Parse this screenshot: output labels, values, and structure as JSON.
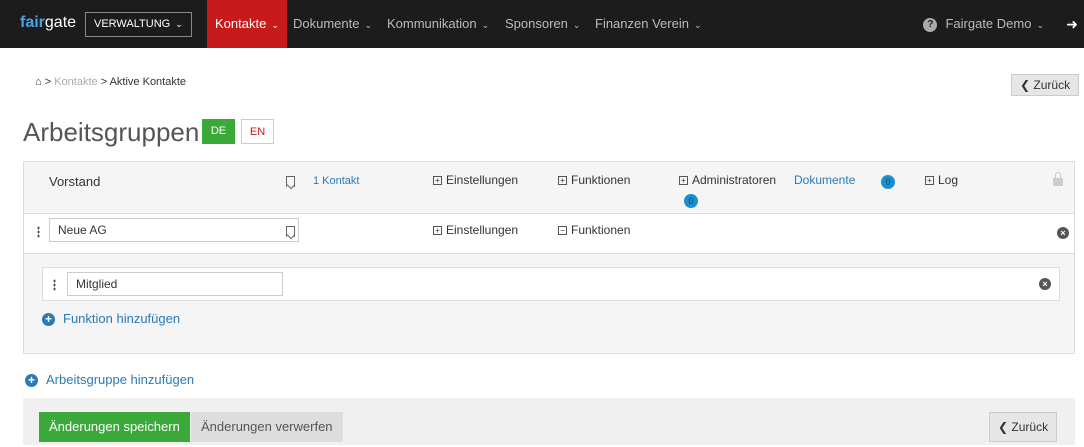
{
  "topbar": {
    "logo_fair": "fair",
    "logo_gate": "gate",
    "module_select": "VERWALTUNG",
    "nav": [
      {
        "label": "Kontakte",
        "active": true
      },
      {
        "label": "Dokumente"
      },
      {
        "label": "Kommunikation"
      },
      {
        "label": "Sponsoren"
      },
      {
        "label": "Finanzen Verein"
      }
    ],
    "user": "Fairgate Demo",
    "help_icon": "?"
  },
  "breadcrumb": {
    "home_icon": "home-icon",
    "level1": "Kontakte",
    "level2": "Aktive Kontakte",
    "separator": ">"
  },
  "back_label": "Zurück",
  "page_title": "Arbeitsgruppen",
  "languages": {
    "de": "DE",
    "en": "EN"
  },
  "groups": [
    {
      "name": "Vorstand",
      "contacts_link": "1 Kontakt",
      "settings": "Einstellungen",
      "functions": "Funktionen",
      "admins": "Administratoren",
      "admins_badge": "0",
      "documents": "Dokumente",
      "documents_badge": "0",
      "log": "Log"
    },
    {
      "name": "Neue AG",
      "settings": "Einstellungen",
      "functions": "Funktionen"
    }
  ],
  "functions_panel": {
    "function_value": "Mitglied",
    "add_function": "Funktion hinzufügen"
  },
  "add_group": "Arbeitsgruppe hinzufügen",
  "footer": {
    "save": "Änderungen speichern",
    "discard": "Änderungen verwerfen",
    "back": "Zurück"
  },
  "colors": {
    "topbar": "#1c1c1c",
    "active_nav": "#c71a1a",
    "accent_green": "#3aa93a",
    "link_blue": "#2a7ab8"
  }
}
